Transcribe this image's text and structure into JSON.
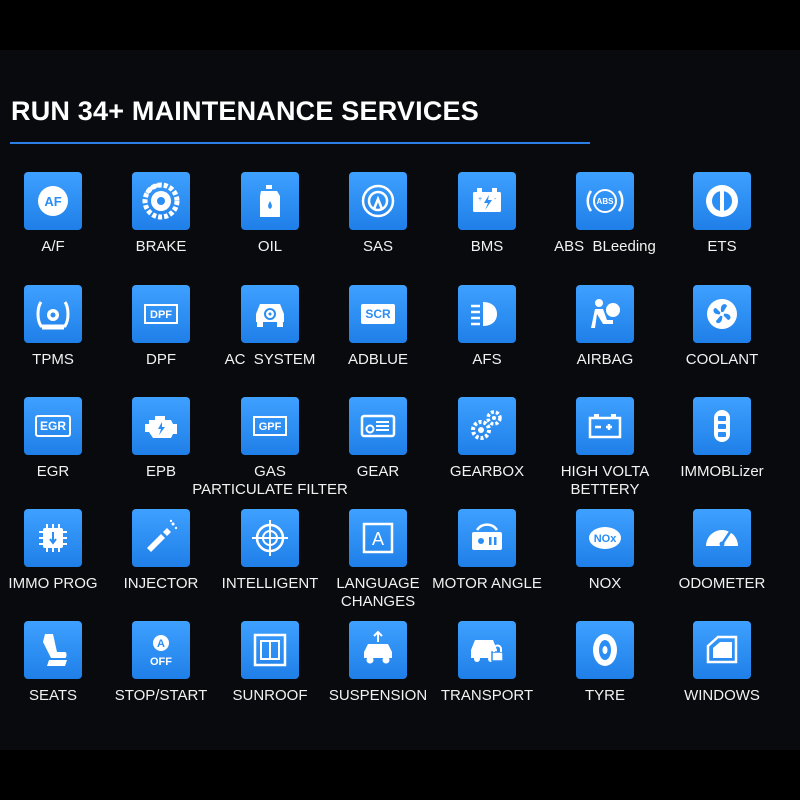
{
  "heading": "RUN 34+ MAINTENANCE SERVICES",
  "colors": {
    "background": "#080a0d",
    "tile": "#2b8ef5",
    "rule": "#2d7fe8",
    "label": "#f2f2f2"
  },
  "rows": [
    [
      {
        "label": "A/F",
        "icon": "af-icon"
      },
      {
        "label": "BRAKE",
        "icon": "brake-disc-icon"
      },
      {
        "label": "OIL",
        "icon": "oil-bottle-icon"
      },
      {
        "label": "SAS",
        "icon": "steering-angle-icon"
      },
      {
        "label": "BMS",
        "icon": "battery-icon"
      },
      {
        "label": "ABS  BLeeding",
        "icon": "abs-icon"
      },
      {
        "label": "ETS",
        "icon": "throttle-icon"
      }
    ],
    [
      {
        "label": "TPMS",
        "icon": "tire-pressure-icon"
      },
      {
        "label": "DPF",
        "icon": "dpf-icon"
      },
      {
        "label": "AC  SYSTEM",
        "icon": "car-ac-icon"
      },
      {
        "label": "ADBLUE",
        "icon": "scr-icon"
      },
      {
        "label": "AFS",
        "icon": "headlight-icon"
      },
      {
        "label": "AIRBAG",
        "icon": "airbag-icon"
      },
      {
        "label": "COOLANT",
        "icon": "fan-icon"
      }
    ],
    [
      {
        "label": "EGR",
        "icon": "egr-icon"
      },
      {
        "label": "EPB",
        "icon": "engine-icon"
      },
      {
        "label": "GAS\nPARTICULATE FILTER",
        "icon": "gpf-icon"
      },
      {
        "label": "GEAR",
        "icon": "gear-card-icon"
      },
      {
        "label": "GEARBOX",
        "icon": "gears-icon"
      },
      {
        "label": "HIGH VOLTA\nBETTERY",
        "icon": "hv-battery-icon"
      },
      {
        "label": "IMMOBLizer",
        "icon": "key-fob-icon"
      }
    ],
    [
      {
        "label": "IMMO PROG",
        "icon": "chip-icon"
      },
      {
        "label": "INJECTOR",
        "icon": "injector-icon"
      },
      {
        "label": "INTELLIGENT",
        "icon": "crosshair-icon"
      },
      {
        "label": "LANGUAGE\nCHANGES",
        "icon": "language-icon"
      },
      {
        "label": "MOTOR ANGLE",
        "icon": "motor-angle-icon"
      },
      {
        "label": "NOX",
        "icon": "nox-icon"
      },
      {
        "label": "ODOMETER",
        "icon": "odometer-icon"
      }
    ],
    [
      {
        "label": "SEATS",
        "icon": "seat-icon"
      },
      {
        "label": "STOP/START",
        "icon": "stop-start-icon"
      },
      {
        "label": "SUNROOF",
        "icon": "sunroof-icon"
      },
      {
        "label": "SUSPENSION",
        "icon": "suspension-icon"
      },
      {
        "label": "TRANSPORT",
        "icon": "transport-lock-icon"
      },
      {
        "label": "TYRE",
        "icon": "tyre-icon"
      },
      {
        "label": "WINDOWS",
        "icon": "window-icon"
      }
    ]
  ],
  "icon_text": {
    "af": "AF",
    "abs": "ABS",
    "dpf": "DPF",
    "scr": "SCR",
    "egr": "EGR",
    "gpf": "GPF",
    "nox": "NOx",
    "stop_a": "A",
    "stop_off": "OFF",
    "lang_a": "A"
  }
}
